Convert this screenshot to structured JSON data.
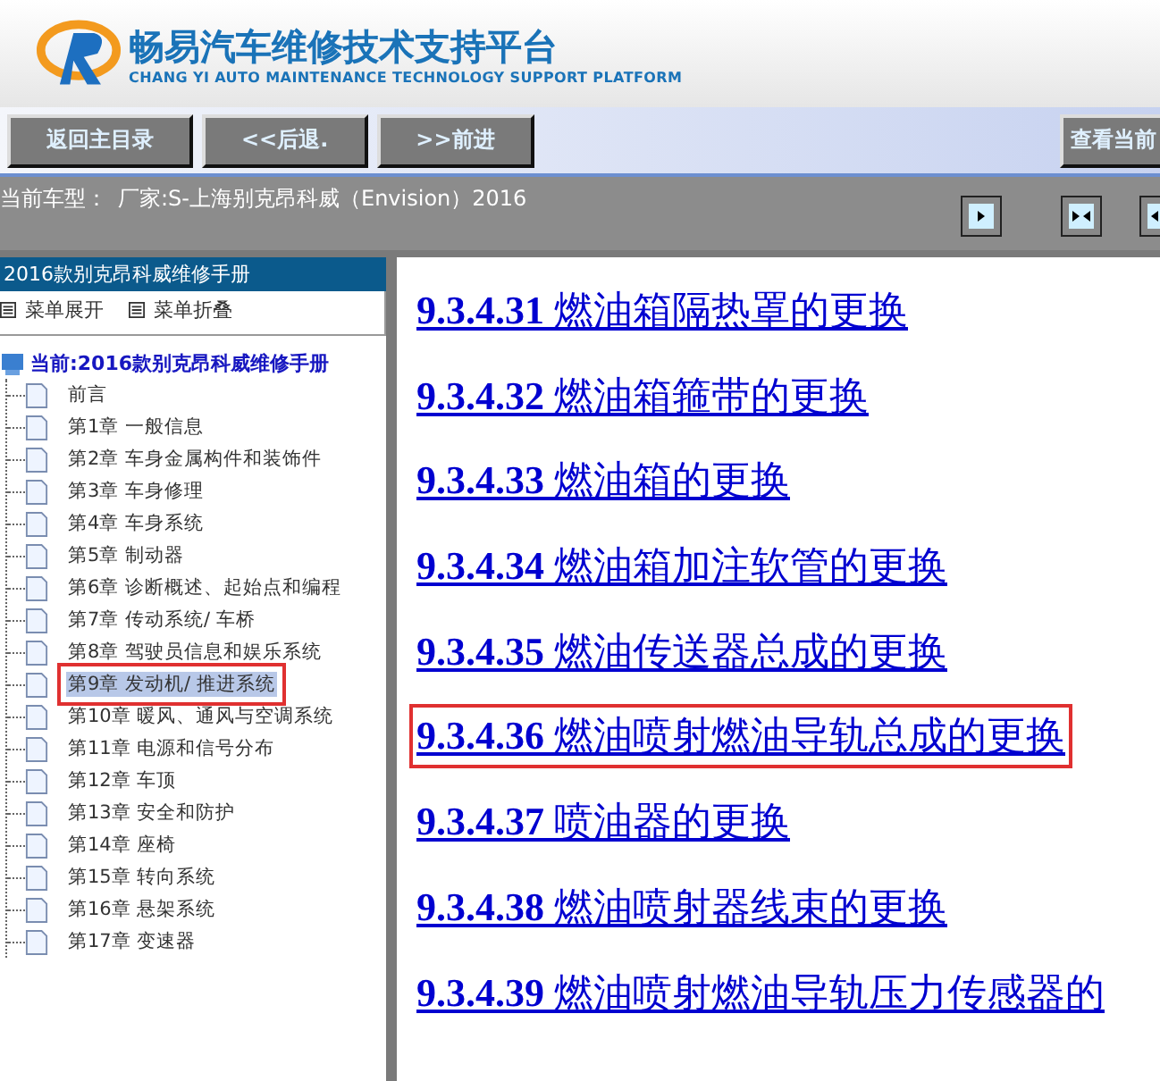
{
  "header": {
    "title": "畅易汽车维修技术支持平台",
    "subtitle": "CHANG YI AUTO MAINTENANCE TECHNOLOGY SUPPORT PLATFORM"
  },
  "toolbar": {
    "buttons": [
      "返回主目录",
      "<<后退.",
      ">>前进"
    ],
    "right_button": "查看当前"
  },
  "car_bar": {
    "label": "当前车型：",
    "value": "厂家:S-上海别克昂科威（Envision）2016"
  },
  "sidebar": {
    "title": "2016款别克昂科威维修手册",
    "actions": [
      "菜单展开",
      "菜单折叠"
    ],
    "tree": {
      "label": "当前:2016款别克昂科威维修手册",
      "children": [
        {
          "label": "前言",
          "selected": false
        },
        {
          "label": "第1章 一般信息",
          "selected": false
        },
        {
          "label": "第2章 车身金属构件和装饰件",
          "selected": false
        },
        {
          "label": "第3章 车身修理",
          "selected": false
        },
        {
          "label": "第4章 车身系统",
          "selected": false
        },
        {
          "label": "第5章 制动器",
          "selected": false
        },
        {
          "label": "第6章 诊断概述、起始点和编程",
          "selected": false
        },
        {
          "label": "第7章 传动系统/ 车桥",
          "selected": false
        },
        {
          "label": "第8章 驾驶员信息和娱乐系统",
          "selected": false
        },
        {
          "label": "第9章 发动机/ 推进系统",
          "selected": true
        },
        {
          "label": "第10章 暖风、通风与空调系统",
          "selected": false
        },
        {
          "label": "第11章 电源和信号分布",
          "selected": false
        },
        {
          "label": "第12章 车顶",
          "selected": false
        },
        {
          "label": "第13章 安全和防护",
          "selected": false
        },
        {
          "label": "第14章 座椅",
          "selected": false
        },
        {
          "label": "第15章 转向系统",
          "selected": false
        },
        {
          "label": "第16章 悬架系统",
          "selected": false
        },
        {
          "label": "第17章 变速器",
          "selected": false
        }
      ]
    }
  },
  "links": [
    {
      "number": "9.3.4.31",
      "title": "燃油箱隔热罩的更换",
      "marked": false
    },
    {
      "number": "9.3.4.32",
      "title": "燃油箱箍带的更换",
      "marked": false
    },
    {
      "number": "9.3.4.33",
      "title": "燃油箱的更换",
      "marked": false
    },
    {
      "number": "9.3.4.34",
      "title": "燃油箱加注软管的更换",
      "marked": false
    },
    {
      "number": "9.3.4.35",
      "title": "燃油传送器总成的更换",
      "marked": false
    },
    {
      "number": "9.3.4.36",
      "title": "燃油喷射燃油导轨总成的更换",
      "marked": true
    },
    {
      "number": "9.3.4.37",
      "title": "喷油器的更换",
      "marked": false
    },
    {
      "number": "9.3.4.38",
      "title": "燃油喷射器线束的更换",
      "marked": false
    },
    {
      "number": "9.3.4.39",
      "title": "燃油喷射燃油导轨压力传感器的",
      "marked": false
    }
  ]
}
